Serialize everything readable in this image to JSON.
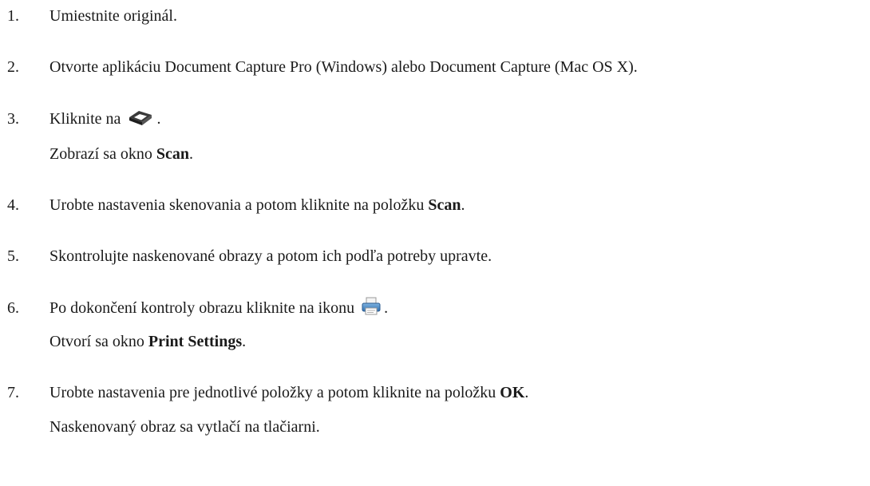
{
  "steps": [
    {
      "num": "1.",
      "text": "Umiestnite originál."
    },
    {
      "num": "2.",
      "text": "Otvorte aplikáciu Document Capture Pro (Windows) alebo Document Capture (Mac OS X)."
    },
    {
      "num": "3.",
      "text_before": "Kliknite na",
      "text_after": ".",
      "icon": "scanner-icon",
      "result_before": "Zobrazí sa okno ",
      "result_bold": "Scan",
      "result_after": "."
    },
    {
      "num": "4.",
      "text_before": "Urobte nastavenia skenovania a potom kliknite na položku ",
      "text_bold": "Scan",
      "text_after": "."
    },
    {
      "num": "5.",
      "text": "Skontrolujte naskenované obrazy a potom ich podľa potreby upravte."
    },
    {
      "num": "6.",
      "text_before": "Po dokončení kontroly obrazu kliknite na ikonu",
      "text_after": ".",
      "icon": "printer-icon",
      "result_before": "Otvorí sa okno ",
      "result_bold": "Print Settings",
      "result_after": "."
    },
    {
      "num": "7.",
      "text_before": "Urobte nastavenia pre jednotlivé položky a potom kliknite na položku ",
      "text_bold": "OK",
      "text_after": ".",
      "result": "Naskenovaný obraz sa vytlačí na tlačiarni."
    }
  ]
}
